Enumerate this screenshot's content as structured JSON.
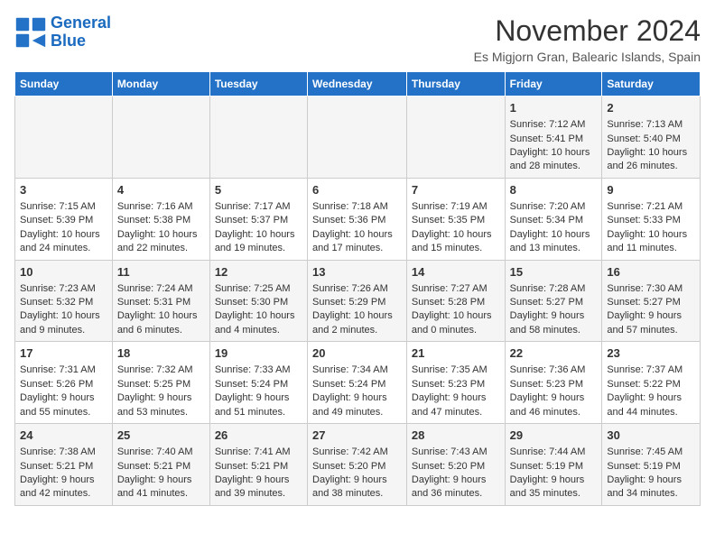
{
  "logo": {
    "line1": "General",
    "line2": "Blue"
  },
  "title": "November 2024",
  "location": "Es Migjorn Gran, Balearic Islands, Spain",
  "days_of_week": [
    "Sunday",
    "Monday",
    "Tuesday",
    "Wednesday",
    "Thursday",
    "Friday",
    "Saturday"
  ],
  "weeks": [
    [
      {
        "day": "",
        "sunrise": "",
        "sunset": "",
        "daylight": ""
      },
      {
        "day": "",
        "sunrise": "",
        "sunset": "",
        "daylight": ""
      },
      {
        "day": "",
        "sunrise": "",
        "sunset": "",
        "daylight": ""
      },
      {
        "day": "",
        "sunrise": "",
        "sunset": "",
        "daylight": ""
      },
      {
        "day": "",
        "sunrise": "",
        "sunset": "",
        "daylight": ""
      },
      {
        "day": "1",
        "sunrise": "Sunrise: 7:12 AM",
        "sunset": "Sunset: 5:41 PM",
        "daylight": "Daylight: 10 hours and 28 minutes."
      },
      {
        "day": "2",
        "sunrise": "Sunrise: 7:13 AM",
        "sunset": "Sunset: 5:40 PM",
        "daylight": "Daylight: 10 hours and 26 minutes."
      }
    ],
    [
      {
        "day": "3",
        "sunrise": "Sunrise: 7:15 AM",
        "sunset": "Sunset: 5:39 PM",
        "daylight": "Daylight: 10 hours and 24 minutes."
      },
      {
        "day": "4",
        "sunrise": "Sunrise: 7:16 AM",
        "sunset": "Sunset: 5:38 PM",
        "daylight": "Daylight: 10 hours and 22 minutes."
      },
      {
        "day": "5",
        "sunrise": "Sunrise: 7:17 AM",
        "sunset": "Sunset: 5:37 PM",
        "daylight": "Daylight: 10 hours and 19 minutes."
      },
      {
        "day": "6",
        "sunrise": "Sunrise: 7:18 AM",
        "sunset": "Sunset: 5:36 PM",
        "daylight": "Daylight: 10 hours and 17 minutes."
      },
      {
        "day": "7",
        "sunrise": "Sunrise: 7:19 AM",
        "sunset": "Sunset: 5:35 PM",
        "daylight": "Daylight: 10 hours and 15 minutes."
      },
      {
        "day": "8",
        "sunrise": "Sunrise: 7:20 AM",
        "sunset": "Sunset: 5:34 PM",
        "daylight": "Daylight: 10 hours and 13 minutes."
      },
      {
        "day": "9",
        "sunrise": "Sunrise: 7:21 AM",
        "sunset": "Sunset: 5:33 PM",
        "daylight": "Daylight: 10 hours and 11 minutes."
      }
    ],
    [
      {
        "day": "10",
        "sunrise": "Sunrise: 7:23 AM",
        "sunset": "Sunset: 5:32 PM",
        "daylight": "Daylight: 10 hours and 9 minutes."
      },
      {
        "day": "11",
        "sunrise": "Sunrise: 7:24 AM",
        "sunset": "Sunset: 5:31 PM",
        "daylight": "Daylight: 10 hours and 6 minutes."
      },
      {
        "day": "12",
        "sunrise": "Sunrise: 7:25 AM",
        "sunset": "Sunset: 5:30 PM",
        "daylight": "Daylight: 10 hours and 4 minutes."
      },
      {
        "day": "13",
        "sunrise": "Sunrise: 7:26 AM",
        "sunset": "Sunset: 5:29 PM",
        "daylight": "Daylight: 10 hours and 2 minutes."
      },
      {
        "day": "14",
        "sunrise": "Sunrise: 7:27 AM",
        "sunset": "Sunset: 5:28 PM",
        "daylight": "Daylight: 10 hours and 0 minutes."
      },
      {
        "day": "15",
        "sunrise": "Sunrise: 7:28 AM",
        "sunset": "Sunset: 5:27 PM",
        "daylight": "Daylight: 9 hours and 58 minutes."
      },
      {
        "day": "16",
        "sunrise": "Sunrise: 7:30 AM",
        "sunset": "Sunset: 5:27 PM",
        "daylight": "Daylight: 9 hours and 57 minutes."
      }
    ],
    [
      {
        "day": "17",
        "sunrise": "Sunrise: 7:31 AM",
        "sunset": "Sunset: 5:26 PM",
        "daylight": "Daylight: 9 hours and 55 minutes."
      },
      {
        "day": "18",
        "sunrise": "Sunrise: 7:32 AM",
        "sunset": "Sunset: 5:25 PM",
        "daylight": "Daylight: 9 hours and 53 minutes."
      },
      {
        "day": "19",
        "sunrise": "Sunrise: 7:33 AM",
        "sunset": "Sunset: 5:24 PM",
        "daylight": "Daylight: 9 hours and 51 minutes."
      },
      {
        "day": "20",
        "sunrise": "Sunrise: 7:34 AM",
        "sunset": "Sunset: 5:24 PM",
        "daylight": "Daylight: 9 hours and 49 minutes."
      },
      {
        "day": "21",
        "sunrise": "Sunrise: 7:35 AM",
        "sunset": "Sunset: 5:23 PM",
        "daylight": "Daylight: 9 hours and 47 minutes."
      },
      {
        "day": "22",
        "sunrise": "Sunrise: 7:36 AM",
        "sunset": "Sunset: 5:23 PM",
        "daylight": "Daylight: 9 hours and 46 minutes."
      },
      {
        "day": "23",
        "sunrise": "Sunrise: 7:37 AM",
        "sunset": "Sunset: 5:22 PM",
        "daylight": "Daylight: 9 hours and 44 minutes."
      }
    ],
    [
      {
        "day": "24",
        "sunrise": "Sunrise: 7:38 AM",
        "sunset": "Sunset: 5:21 PM",
        "daylight": "Daylight: 9 hours and 42 minutes."
      },
      {
        "day": "25",
        "sunrise": "Sunrise: 7:40 AM",
        "sunset": "Sunset: 5:21 PM",
        "daylight": "Daylight: 9 hours and 41 minutes."
      },
      {
        "day": "26",
        "sunrise": "Sunrise: 7:41 AM",
        "sunset": "Sunset: 5:21 PM",
        "daylight": "Daylight: 9 hours and 39 minutes."
      },
      {
        "day": "27",
        "sunrise": "Sunrise: 7:42 AM",
        "sunset": "Sunset: 5:20 PM",
        "daylight": "Daylight: 9 hours and 38 minutes."
      },
      {
        "day": "28",
        "sunrise": "Sunrise: 7:43 AM",
        "sunset": "Sunset: 5:20 PM",
        "daylight": "Daylight: 9 hours and 36 minutes."
      },
      {
        "day": "29",
        "sunrise": "Sunrise: 7:44 AM",
        "sunset": "Sunset: 5:19 PM",
        "daylight": "Daylight: 9 hours and 35 minutes."
      },
      {
        "day": "30",
        "sunrise": "Sunrise: 7:45 AM",
        "sunset": "Sunset: 5:19 PM",
        "daylight": "Daylight: 9 hours and 34 minutes."
      }
    ]
  ]
}
